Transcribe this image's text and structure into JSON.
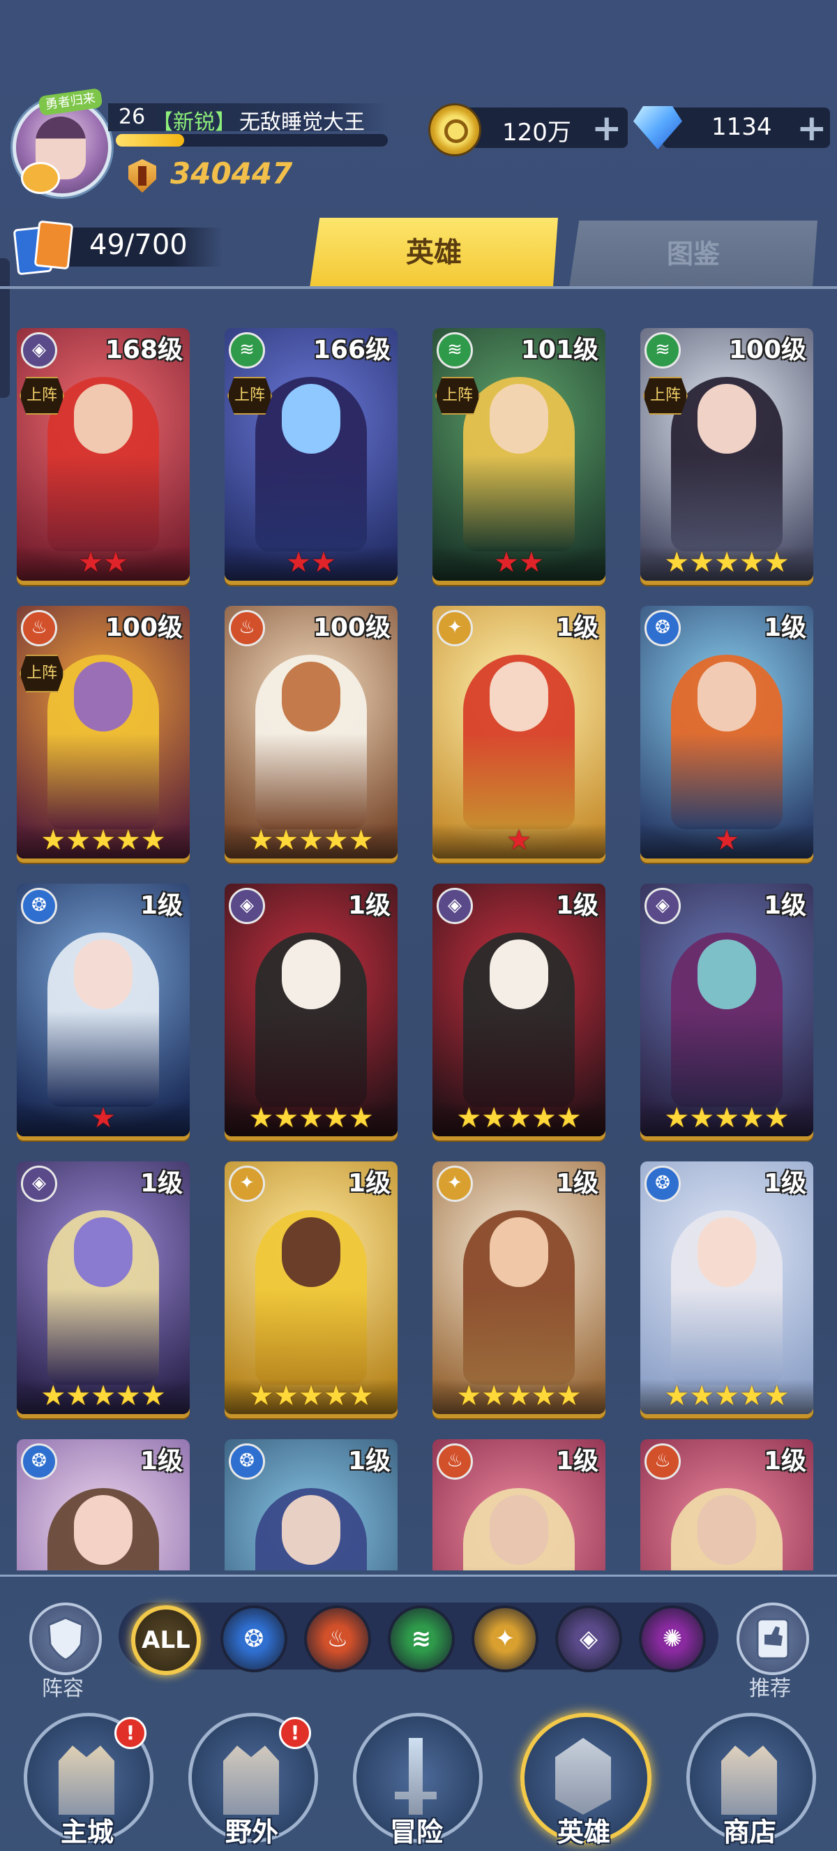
{
  "player": {
    "avatar_tag": "勇者归来",
    "level": "26",
    "rank": "【新锐】",
    "name": "无敌睡觉大王",
    "xp_fraction": 0.25,
    "power": "340447"
  },
  "resources": {
    "gold": "120万",
    "gems": "1134",
    "gold_plus": "+",
    "gems_plus": "+"
  },
  "hero_count": "49/700",
  "tabs": {
    "heroes": "英雄",
    "codex": "图鉴"
  },
  "deploy_label": "上阵",
  "heroes": [
    {
      "level": "168级",
      "element": "dark",
      "deployed": true,
      "stars": 2,
      "star_color": "red",
      "art": [
        "#f06a70",
        "#7a2030"
      ],
      "skin": "#f0c9b0",
      "hair": "#d8342e"
    },
    {
      "level": "166级",
      "element": "wind",
      "deployed": true,
      "stars": 2,
      "star_color": "red",
      "art": [
        "#6a78d8",
        "#25306a"
      ],
      "skin": "#8fc8ff",
      "hair": "#2a2660"
    },
    {
      "level": "101级",
      "element": "wind",
      "deployed": true,
      "stars": 2,
      "star_color": "red",
      "art": [
        "#5ea36a",
        "#1d3a2c"
      ],
      "skin": "#f3d4b0",
      "hair": "#e8c24e"
    },
    {
      "level": "100级",
      "element": "wind",
      "deployed": true,
      "stars": 5,
      "star_color": "gold",
      "art": [
        "#dfe6ef",
        "#4b4e68"
      ],
      "skin": "#f0d2c6",
      "hair": "#2a2436"
    },
    {
      "level": "100级",
      "element": "fire",
      "deployed": true,
      "stars": 5,
      "star_color": "gold",
      "art": [
        "#f3a23a",
        "#5a2238"
      ],
      "skin": "#9b6fb6",
      "hair": "#f0c034"
    },
    {
      "level": "100级",
      "element": "fire",
      "deployed": false,
      "stars": 5,
      "star_color": "gold",
      "art": [
        "#f4ddc0",
        "#7a4a2e"
      ],
      "skin": "#c47a4a",
      "hair": "#f5f0e6"
    },
    {
      "level": "1级",
      "element": "light",
      "deployed": false,
      "stars": 1,
      "star_color": "red",
      "art": [
        "#fff2b0",
        "#c78e2e"
      ],
      "skin": "#f6d6c4",
      "hair": "#d8402a"
    },
    {
      "level": "1级",
      "element": "water",
      "deployed": false,
      "stars": 1,
      "star_color": "red",
      "art": [
        "#8ad0f0",
        "#2a3e6a"
      ],
      "skin": "#f2cbb4",
      "hair": "#e46a2a"
    },
    {
      "level": "1级",
      "element": "water",
      "deployed": false,
      "stars": 1,
      "star_color": "red",
      "art": [
        "#7aa6d8",
        "#1a2a56"
      ],
      "skin": "#f4dcd4",
      "hair": "#dfe8f2"
    },
    {
      "level": "1级",
      "element": "dark",
      "deployed": false,
      "stars": 5,
      "star_color": "gold",
      "art": [
        "#c83040",
        "#2a1218"
      ],
      "skin": "#f4eee6",
      "hair": "#2a2a2a"
    },
    {
      "level": "1级",
      "element": "dark",
      "deployed": false,
      "stars": 5,
      "star_color": "gold",
      "art": [
        "#c83040",
        "#2a1218"
      ],
      "skin": "#f4eee6",
      "hair": "#2a2a2a"
    },
    {
      "level": "1级",
      "element": "dark",
      "deployed": false,
      "stars": 5,
      "star_color": "gold",
      "art": [
        "#6a7ab8",
        "#2a2244"
      ],
      "skin": "#7ec0c8",
      "hair": "#6a2a6a"
    },
    {
      "level": "1级",
      "element": "dark",
      "deployed": false,
      "stars": 5,
      "star_color": "gold",
      "art": [
        "#9c8ad8",
        "#2e2650"
      ],
      "skin": "#8a7ad0",
      "hair": "#e8d8a0"
    },
    {
      "level": "1级",
      "element": "light",
      "deployed": false,
      "stars": 5,
      "star_color": "gold",
      "art": [
        "#ffeaa0",
        "#b8861e"
      ],
      "skin": "#6a3e28",
      "hair": "#f0c838"
    },
    {
      "level": "1级",
      "element": "light",
      "deployed": false,
      "stars": 5,
      "star_color": "gold",
      "art": [
        "#f6ead8",
        "#9a6a3a"
      ],
      "skin": "#f0c8a8",
      "hair": "#8a4a2a"
    },
    {
      "level": "1级",
      "element": "water",
      "deployed": false,
      "stars": 5,
      "star_color": "gold",
      "art": [
        "#dfe6f6",
        "#8ea2c8"
      ],
      "skin": "#f6dcd0",
      "hair": "#e6e6ee"
    },
    {
      "level": "1级",
      "element": "water",
      "deployed": false,
      "stars": 0,
      "star_color": "gold",
      "art": [
        "#f0d8ee",
        "#7a5aa0"
      ],
      "skin": "#f4d2c6",
      "hair": "#6a4a38"
    },
    {
      "level": "1级",
      "element": "water",
      "deployed": false,
      "stars": 0,
      "star_color": "gold",
      "art": [
        "#8ac8e8",
        "#2a4a6a"
      ],
      "skin": "#e8d0c4",
      "hair": "#3a4a8a"
    },
    {
      "level": "1级",
      "element": "fire",
      "deployed": false,
      "stars": 0,
      "star_color": "gold",
      "art": [
        "#f08aa0",
        "#7a2040"
      ],
      "skin": "#e8c6b0",
      "hair": "#efd8a8"
    },
    {
      "level": "1级",
      "element": "fire",
      "deployed": false,
      "stars": 0,
      "star_color": "gold",
      "art": [
        "#f08aa0",
        "#7a2040"
      ],
      "skin": "#e8c6b0",
      "hair": "#efd8a8"
    }
  ],
  "element_colors": {
    "dark": "#5a4a8a",
    "wind": "#2e9a4a",
    "fire": "#d2502a",
    "water": "#2f6fd0",
    "light": "#d9a030",
    "arcane": "#8a2aa0"
  },
  "filter": {
    "lineup_label": "阵容",
    "recommend_label": "推荐",
    "all_label": "ALL",
    "elements": [
      "water",
      "fire",
      "wind",
      "light",
      "dark",
      "arcane"
    ]
  },
  "nav": [
    {
      "label": "主城",
      "alert": true,
      "icon": "castle-icon"
    },
    {
      "label": "野外",
      "alert": true,
      "icon": "portal-icon"
    },
    {
      "label": "冒险",
      "alert": false,
      "icon": "sword-icon"
    },
    {
      "label": "英雄",
      "alert": false,
      "active": true,
      "icon": "knight-helmet-icon"
    },
    {
      "label": "商店",
      "alert": false,
      "icon": "shop-icon"
    }
  ],
  "alert_mark": "!"
}
